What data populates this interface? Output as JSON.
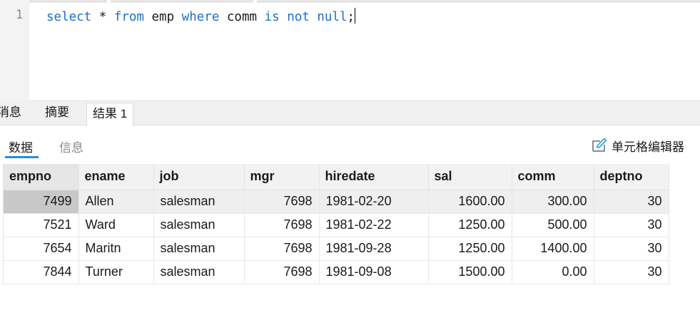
{
  "editor": {
    "line_number": "1",
    "tokens": [
      {
        "text": "select",
        "kind": "kw"
      },
      {
        "text": " * ",
        "kind": "plain"
      },
      {
        "text": "from",
        "kind": "kw"
      },
      {
        "text": " emp ",
        "kind": "plain"
      },
      {
        "text": "where",
        "kind": "kw"
      },
      {
        "text": " comm ",
        "kind": "plain"
      },
      {
        "text": "is",
        "kind": "kw"
      },
      {
        "text": " ",
        "kind": "plain"
      },
      {
        "text": "not",
        "kind": "kw"
      },
      {
        "text": " ",
        "kind": "plain"
      },
      {
        "text": "null",
        "kind": "kw"
      },
      {
        "text": ";",
        "kind": "plain"
      }
    ],
    "keyword_color": "#1f6fc6"
  },
  "result_tabs": {
    "messages": "消息",
    "summary": "摘要",
    "result": "结果 1"
  },
  "sub_tabs": {
    "data": "数据",
    "info": "信息",
    "cell_editor": "单元格编辑器"
  },
  "accent_color": "#1e90e0",
  "grid": {
    "columns": [
      {
        "label": "empno",
        "align": "num"
      },
      {
        "label": "ename",
        "align": "txt"
      },
      {
        "label": "job",
        "align": "txt"
      },
      {
        "label": "mgr",
        "align": "num"
      },
      {
        "label": "hiredate",
        "align": "txt"
      },
      {
        "label": "sal",
        "align": "num"
      },
      {
        "label": "comm",
        "align": "num"
      },
      {
        "label": "deptno",
        "align": "num"
      }
    ],
    "rows": [
      [
        "7499",
        "Allen",
        "salesman",
        "7698",
        "1981-02-20",
        "1600.00",
        "300.00",
        "30"
      ],
      [
        "7521",
        "Ward",
        "salesman",
        "7698",
        "1981-02-22",
        "1250.00",
        "500.00",
        "30"
      ],
      [
        "7654",
        "Maritn",
        "salesman",
        "7698",
        "1981-09-28",
        "1250.00",
        "1400.00",
        "30"
      ],
      [
        "7844",
        "Turner",
        "salesman",
        "7698",
        "1981-09-08",
        "1500.00",
        "0.00",
        "30"
      ]
    ],
    "selected_row": 0
  }
}
